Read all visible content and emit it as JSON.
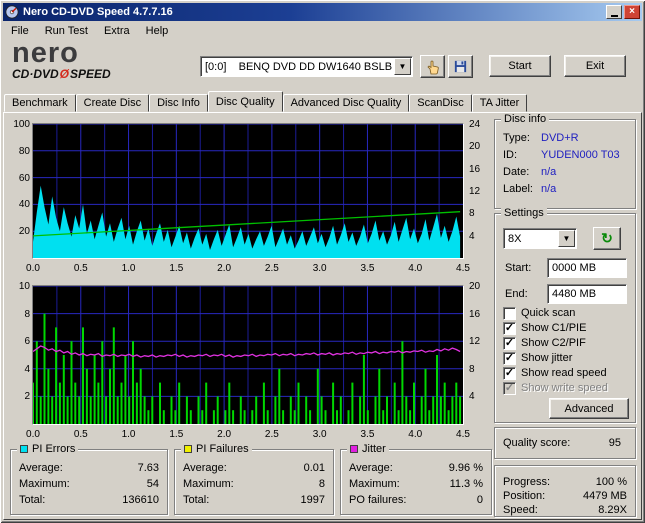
{
  "window": {
    "title": "Nero CD-DVD Speed 4.7.7.16"
  },
  "menu": {
    "items": [
      "File",
      "Run Test",
      "Extra",
      "Help"
    ]
  },
  "logo": {
    "brand": "nero",
    "product_left": "CD·DVD",
    "slash": "Ø",
    "product_right": "SPEED"
  },
  "toolbar": {
    "drive_select": "[0:0]    BENQ DVD DD DW1640 BSLB",
    "start_label": "Start",
    "exit_label": "Exit"
  },
  "tabs": {
    "items": [
      "Benchmark",
      "Create Disc",
      "Disc Info",
      "Disc Quality",
      "Advanced Disc Quality",
      "ScanDisc",
      "TA Jitter"
    ],
    "active": "Disc Quality"
  },
  "disc_info": {
    "title": "Disc info",
    "rows": [
      {
        "label": "Type:",
        "value": "DVD+R"
      },
      {
        "label": "ID:",
        "value": "YUDEN000 T03"
      },
      {
        "label": "Date:",
        "value": "n/a"
      },
      {
        "label": "Label:",
        "value": "n/a"
      }
    ]
  },
  "settings": {
    "title": "Settings",
    "speed": "8X",
    "start_label": "Start:",
    "start_value": "0000 MB",
    "end_label": "End:",
    "end_value": "4480 MB",
    "checkboxes": [
      {
        "label": "Quick scan",
        "checked": false,
        "disabled": false
      },
      {
        "label": "Show C1/PIE",
        "checked": true,
        "disabled": false
      },
      {
        "label": "Show C2/PIF",
        "checked": true,
        "disabled": false
      },
      {
        "label": "Show jitter",
        "checked": true,
        "disabled": false
      },
      {
        "label": "Show read speed",
        "checked": true,
        "disabled": false
      },
      {
        "label": "Show write speed",
        "checked": true,
        "disabled": true
      }
    ],
    "advanced_label": "Advanced"
  },
  "quality": {
    "label": "Quality score:",
    "value": "95"
  },
  "progress": {
    "rows": [
      {
        "label": "Progress:",
        "value": "100 %"
      },
      {
        "label": "Position:",
        "value": "4479 MB"
      },
      {
        "label": "Speed:",
        "value": "8.29X"
      }
    ]
  },
  "stats": [
    {
      "title": "PI Errors",
      "color": "#00e0f0",
      "rows": [
        [
          "Average:",
          "7.63"
        ],
        [
          "Maximum:",
          "54"
        ],
        [
          "Total:",
          "136610"
        ]
      ]
    },
    {
      "title": "PI Failures",
      "color": "#f0f000",
      "rows": [
        [
          "Average:",
          "0.01"
        ],
        [
          "Maximum:",
          "8"
        ],
        [
          "Total:",
          "1997"
        ]
      ]
    },
    {
      "title": "Jitter",
      "color": "#e020e0",
      "rows": [
        [
          "Average:",
          "9.96 %"
        ],
        [
          "Maximum:",
          "11.3 %"
        ],
        [
          "PO failures:",
          "0"
        ]
      ]
    }
  ],
  "icons": {
    "dropdown": "▼",
    "check": "✓",
    "close": "×",
    "refresh": "↻"
  },
  "chart_data": [
    {
      "type": "area",
      "title": "PI Errors vs position with read speed",
      "x_range": [
        0,
        4.5
      ],
      "x_unit": "GB",
      "x_ticks": [
        "0.0",
        "0.5",
        "1.0",
        "1.5",
        "2.0",
        "2.5",
        "3.0",
        "3.5",
        "4.0",
        "4.5"
      ],
      "left_axis": {
        "range": [
          0,
          100
        ],
        "ticks": [
          100,
          80,
          60,
          40,
          20
        ]
      },
      "right_axis": {
        "range": [
          0,
          24
        ],
        "ticks": [
          24,
          20,
          16,
          12,
          8,
          4
        ]
      },
      "grid": true,
      "grid_color": "#2828c0",
      "bg": "#000000",
      "series": [
        {
          "name": "PI Errors",
          "style": "area",
          "color": "#00e0f0",
          "scale": "left",
          "x_end": 4.47,
          "values": [
            12,
            34,
            54,
            38,
            25,
            46,
            30,
            20,
            38,
            26,
            16,
            32,
            22,
            40,
            18,
            28,
            14,
            24,
            34,
            16,
            26,
            12,
            22,
            30,
            14,
            24,
            10,
            20,
            28,
            13,
            22,
            9,
            18,
            26,
            12,
            21,
            8,
            16,
            24,
            11,
            19,
            7,
            15,
            22,
            10,
            18,
            6,
            14,
            21,
            9,
            17,
            25,
            8,
            15,
            23,
            10,
            18,
            7,
            14,
            20,
            9,
            16,
            24,
            8,
            15,
            22,
            10,
            17,
            7,
            13,
            20,
            9,
            16,
            23,
            11,
            18,
            8,
            15,
            24,
            10,
            17,
            26,
            12,
            19,
            9,
            16,
            25,
            11,
            18,
            28,
            13,
            20,
            10,
            17,
            27,
            12,
            21,
            30,
            14,
            22,
            11,
            18,
            29,
            13,
            23,
            33,
            15,
            24,
            12,
            20,
            31,
            16
          ]
        },
        {
          "name": "Read speed",
          "style": "line",
          "color": "#00c000",
          "scale": "right",
          "x": [
            0,
            4.47
          ],
          "values": [
            3.95,
            8.29
          ]
        }
      ]
    },
    {
      "type": "bar",
      "title": "PI Failures vs position with jitter",
      "x_range": [
        0,
        4.5
      ],
      "x_unit": "GB",
      "x_ticks": [
        "0.0",
        "0.5",
        "1.0",
        "1.5",
        "2.0",
        "2.5",
        "3.0",
        "3.5",
        "4.0",
        "4.5"
      ],
      "left_axis": {
        "range": [
          0,
          10
        ],
        "ticks": [
          10,
          8,
          6,
          4,
          2
        ]
      },
      "right_axis": {
        "range": [
          0,
          20
        ],
        "ticks": [
          20,
          16,
          12,
          8,
          4
        ]
      },
      "grid": true,
      "grid_color": "#2828c0",
      "bg": "#000000",
      "series": [
        {
          "name": "PI Failures",
          "style": "bars",
          "color": "#00d800",
          "scale": "left",
          "x_end": 4.47,
          "values": [
            3,
            6,
            2,
            8,
            4,
            2,
            7,
            3,
            5,
            2,
            6,
            3,
            2,
            7,
            4,
            2,
            5,
            3,
            6,
            2,
            4,
            7,
            2,
            3,
            5,
            2,
            6,
            3,
            4,
            2,
            1,
            2,
            0,
            3,
            1,
            0,
            2,
            1,
            3,
            0,
            2,
            1,
            0,
            2,
            1,
            3,
            0,
            1,
            2,
            0,
            1,
            3,
            1,
            0,
            2,
            1,
            0,
            1,
            2,
            0,
            3,
            1,
            0,
            2,
            4,
            1,
            0,
            2,
            1,
            3,
            0,
            2,
            1,
            0,
            4,
            2,
            1,
            0,
            3,
            1,
            2,
            0,
            1,
            3,
            0,
            2,
            5,
            1,
            0,
            2,
            4,
            1,
            2,
            0,
            3,
            1,
            6,
            2,
            1,
            3,
            0,
            2,
            4,
            1,
            2,
            5,
            2,
            3,
            1,
            2,
            3,
            2
          ]
        },
        {
          "name": "Jitter",
          "style": "line",
          "color": "#e032e0",
          "scale": "right",
          "x_end": 4.47,
          "values": [
            10.5,
            10.9,
            11.3,
            11.1,
            10.7,
            10.9,
            10.5,
            10.7,
            10.3,
            10.5,
            10.1,
            10.3,
            10.0,
            10.2,
            9.9,
            10.1,
            10.0,
            10.2,
            9.8,
            10.0,
            9.9,
            10.1,
            9.8,
            10.0,
            9.9,
            10.1,
            9.8,
            10.0,
            9.7,
            9.9,
            9.8,
            10.0,
            9.7,
            9.9,
            9.8,
            10.0,
            9.9,
            10.1,
            9.8,
            10.0,
            9.7,
            9.9,
            9.8,
            10.0,
            9.9,
            10.1,
            9.8,
            10.0,
            9.9,
            10.1,
            9.8,
            10.0,
            9.7,
            9.9,
            9.8,
            10.0,
            9.9,
            10.1,
            9.8,
            10.0,
            9.9,
            10.1,
            10.0,
            10.2,
            9.9,
            10.1,
            10.0,
            10.2,
            9.9,
            10.1,
            10.0,
            10.2,
            10.1,
            10.3,
            10.0,
            10.2,
            10.1,
            10.3,
            10.0,
            10.2,
            10.1,
            10.3,
            10.2,
            10.4,
            10.1,
            10.3,
            10.2,
            10.4,
            10.3,
            10.5,
            10.2,
            10.4,
            10.3,
            10.5,
            10.4,
            10.6,
            10.3,
            10.5,
            10.4,
            10.6,
            10.5,
            10.7,
            10.4,
            10.6,
            10.5,
            10.8,
            10.6,
            10.9,
            10.7,
            11.0,
            10.8,
            10.5
          ]
        }
      ]
    }
  ]
}
